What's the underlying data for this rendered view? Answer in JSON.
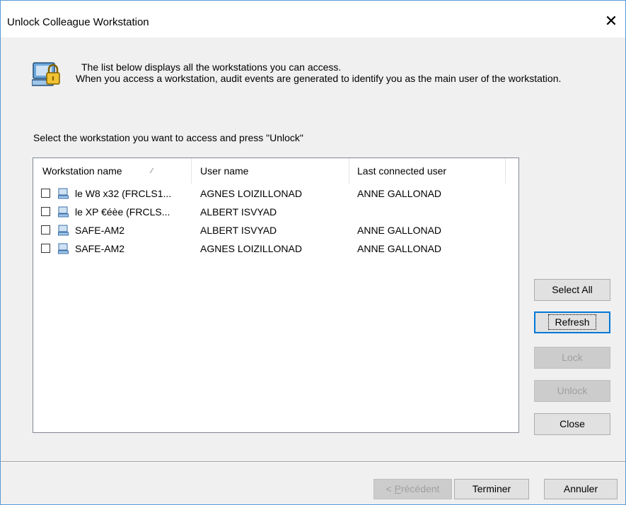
{
  "window": {
    "title": "Unlock Colleague Workstation",
    "close_glyph": "✕"
  },
  "info": {
    "line1": "The list below displays all the workstations you can access.",
    "line2": "When you access a workstation, audit events are generated to identify you as the main user of the workstation.",
    "icon": "workstation-lock-icon"
  },
  "prompt": "Select the workstation you want to access and press \"Unlock\"",
  "table": {
    "columns": [
      "Workstation name",
      "User name",
      "Last connected user"
    ],
    "sort_glyph": "⁄",
    "rows": [
      {
        "workstation": "le W8 x32 (FRCLS1...",
        "user": "AGNES LOIZILLONAD",
        "last_user": "ANNE GALLONAD",
        "checked": false
      },
      {
        "workstation": "le XP €éèe (FRCLS...",
        "user": "ALBERT ISVYAD",
        "last_user": "",
        "checked": false
      },
      {
        "workstation": "SAFE-AM2",
        "user": "ALBERT ISVYAD",
        "last_user": "ANNE GALLONAD",
        "checked": false
      },
      {
        "workstation": "SAFE-AM2",
        "user": "AGNES LOIZILLONAD",
        "last_user": "ANNE GALLONAD",
        "checked": false
      }
    ]
  },
  "side_buttons": {
    "select_all": "Select All",
    "refresh": "Refresh",
    "lock": "Lock",
    "unlock": "Unlock",
    "close": "Close"
  },
  "wizard_buttons": {
    "previous_prefix": "< ",
    "previous_accel": "P",
    "previous_rest": "récédent",
    "finish": "Terminer",
    "cancel": "Annuler"
  },
  "colors": {
    "window_border": "#5a9bd5",
    "dialog_bg": "#f0f0f0",
    "default_button_border": "#0078d7"
  }
}
